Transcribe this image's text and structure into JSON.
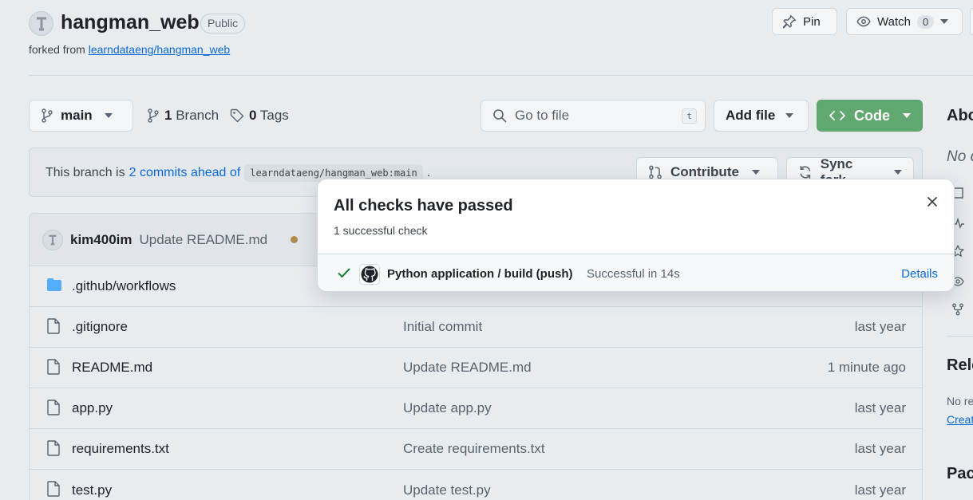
{
  "repo": {
    "name": "hangman_web",
    "visibility": "Public",
    "forked_prefix": "forked from",
    "forked_source": "learndataeng/hangman_web"
  },
  "header_actions": {
    "pin_label": "Pin",
    "watch_label": "Watch",
    "watch_count": "0"
  },
  "toolbar": {
    "branch": "main",
    "branch_count": "1",
    "branch_word": "Branch",
    "tag_count": "0",
    "tag_word": "Tags",
    "search_placeholder": "Go to file",
    "search_shortcut": "t",
    "add_file_label": "Add file",
    "code_label": "Code"
  },
  "ahead": {
    "prefix": "This branch is",
    "link": "2 commits ahead of",
    "ref": "learndataeng/hangman_web:main",
    "suffix": ".",
    "contribute_label": "Contribute",
    "sync_label": "Sync fork"
  },
  "latest_commit": {
    "author": "kim400im",
    "message": "Update README.md"
  },
  "files": [
    {
      "name": ".github/workflows",
      "type": "folder",
      "message": "",
      "date": ""
    },
    {
      "name": ".gitignore",
      "type": "file",
      "message": "Initial commit",
      "date": "last year"
    },
    {
      "name": "README.md",
      "type": "file",
      "message": "Update README.md",
      "date": "1 minute ago"
    },
    {
      "name": "app.py",
      "type": "file",
      "message": "Update app.py",
      "date": "last year"
    },
    {
      "name": "requirements.txt",
      "type": "file",
      "message": "Create requirements.txt",
      "date": "last year"
    },
    {
      "name": "test.py",
      "type": "file",
      "message": "Update test.py",
      "date": "last year"
    }
  ],
  "sidebar": {
    "about_heading": "Abo",
    "no_desc": "No d",
    "releases_heading": "Rele",
    "no_releases": "No re",
    "create_link": "Creat",
    "packages_heading": "Pacl"
  },
  "checks_popup": {
    "title": "All checks have passed",
    "subtitle": "1 successful check",
    "check_name": "Python application / build (push)",
    "check_status": "Successful in 14s",
    "details_label": "Details"
  },
  "colors": {
    "accent_link": "#0969da",
    "code_button": "#61a870",
    "success_check": "#1a7f37"
  }
}
